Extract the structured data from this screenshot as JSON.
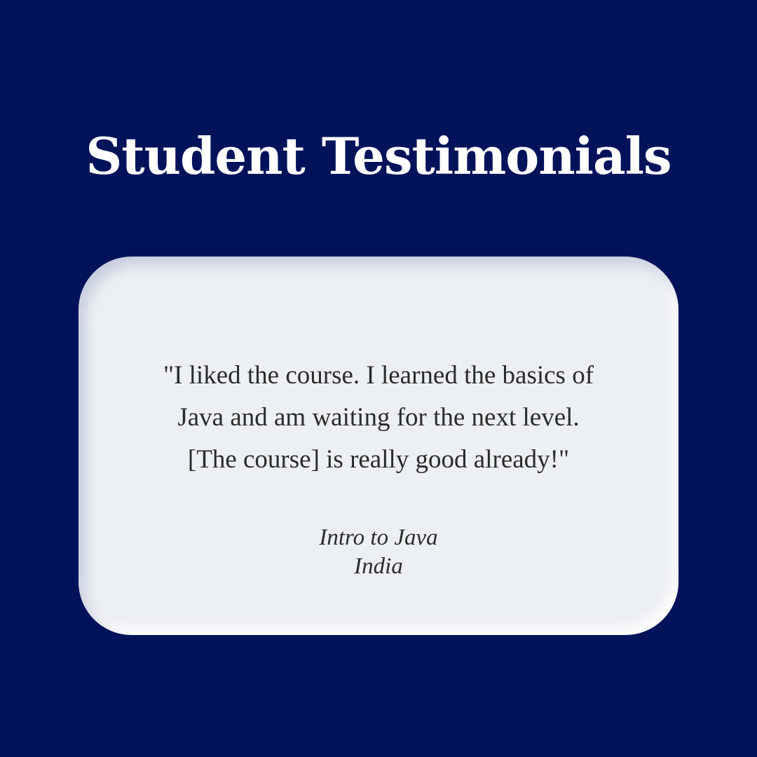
{
  "header": {
    "title": "Student Testimonials"
  },
  "testimonial": {
    "quote_lines": [
      "\"I liked the course. I learned the basics of",
      "Java and am waiting for the next level.",
      "[The course] is really good already!\""
    ],
    "course": "Intro to Java",
    "country": "India"
  },
  "colors": {
    "background": "#00125a",
    "card": "#edf0f3",
    "title_text": "#ffffff",
    "body_text": "#2b2b2b"
  }
}
